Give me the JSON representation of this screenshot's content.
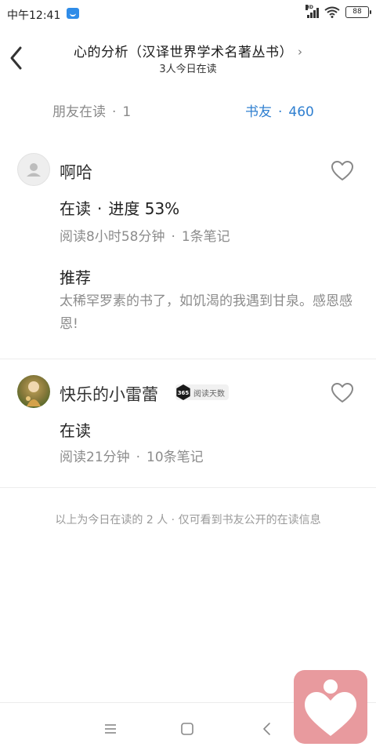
{
  "status_bar": {
    "time": "中午12:41",
    "battery": "88",
    "network": "HD"
  },
  "header": {
    "title": "心的分析（汉译世界学术名著丛书）",
    "subtitle": "3人今日在读"
  },
  "tabs": {
    "friends_label": "朋友在读",
    "friends_count": "1",
    "bookfriends_label": "书友",
    "bookfriends_count": "460",
    "separator": "·"
  },
  "entries": [
    {
      "username": "啊哈",
      "status": "在读",
      "progress": "进度 53%",
      "progress_value": 53,
      "read_time": "阅读8小时58分钟",
      "notes": "1条笔记",
      "recommend_heading": "推荐",
      "recommend_text": "太稀罕罗素的书了，如饥渴的我遇到甘泉。感恩感恩!"
    },
    {
      "username": "快乐的小雷蕾",
      "badge_number": "365",
      "badge_label": "阅读天数",
      "status": "在读",
      "read_time": "阅读21分钟",
      "notes": "10条笔记"
    }
  ],
  "footer_note": "以上为今日在读的 2 人 · 仅可看到书友公开的在读信息",
  "icons": {
    "back": "chevron-left-icon",
    "heart": "heart-outline-icon",
    "menu": "menu-icon",
    "home": "square-icon",
    "nav_back": "triangle-back-icon",
    "floating": "heart-person-icon"
  },
  "colors": {
    "accent": "#2f7fd0",
    "muted": "#8c8c8c",
    "floating_bg": "#e89a9e"
  }
}
